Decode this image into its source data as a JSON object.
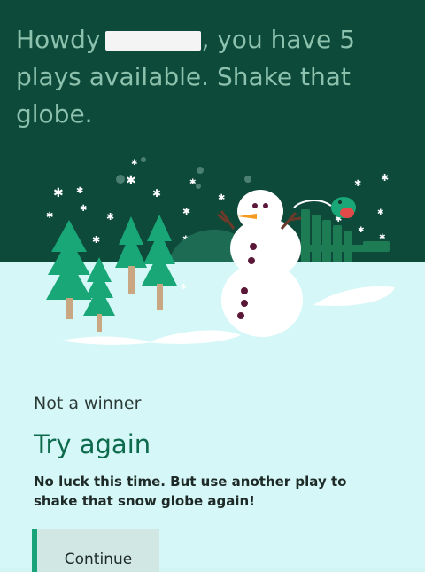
{
  "header": {
    "greeting_prefix": "Howdy",
    "greeting_suffix": ", you have 5 plays available. Shake that globe."
  },
  "result": {
    "status": "Not a winner",
    "title": "Try again",
    "message": "No luck this time. But use another play to shake that snow globe again!",
    "continue_label": "Continue"
  },
  "colors": {
    "hero_bg": "#0e4a3a",
    "headline": "#8cc1ad",
    "ice_bg": "#d6f7f7",
    "title_green": "#0d6a4d",
    "button_bg": "#d0e7e4",
    "button_accent": "#19a37a"
  },
  "scene": {
    "icons": [
      "snowman-icon",
      "pine-tree-icon",
      "bird-icon",
      "snowflake-icon",
      "adirondack-chair-icon"
    ]
  }
}
